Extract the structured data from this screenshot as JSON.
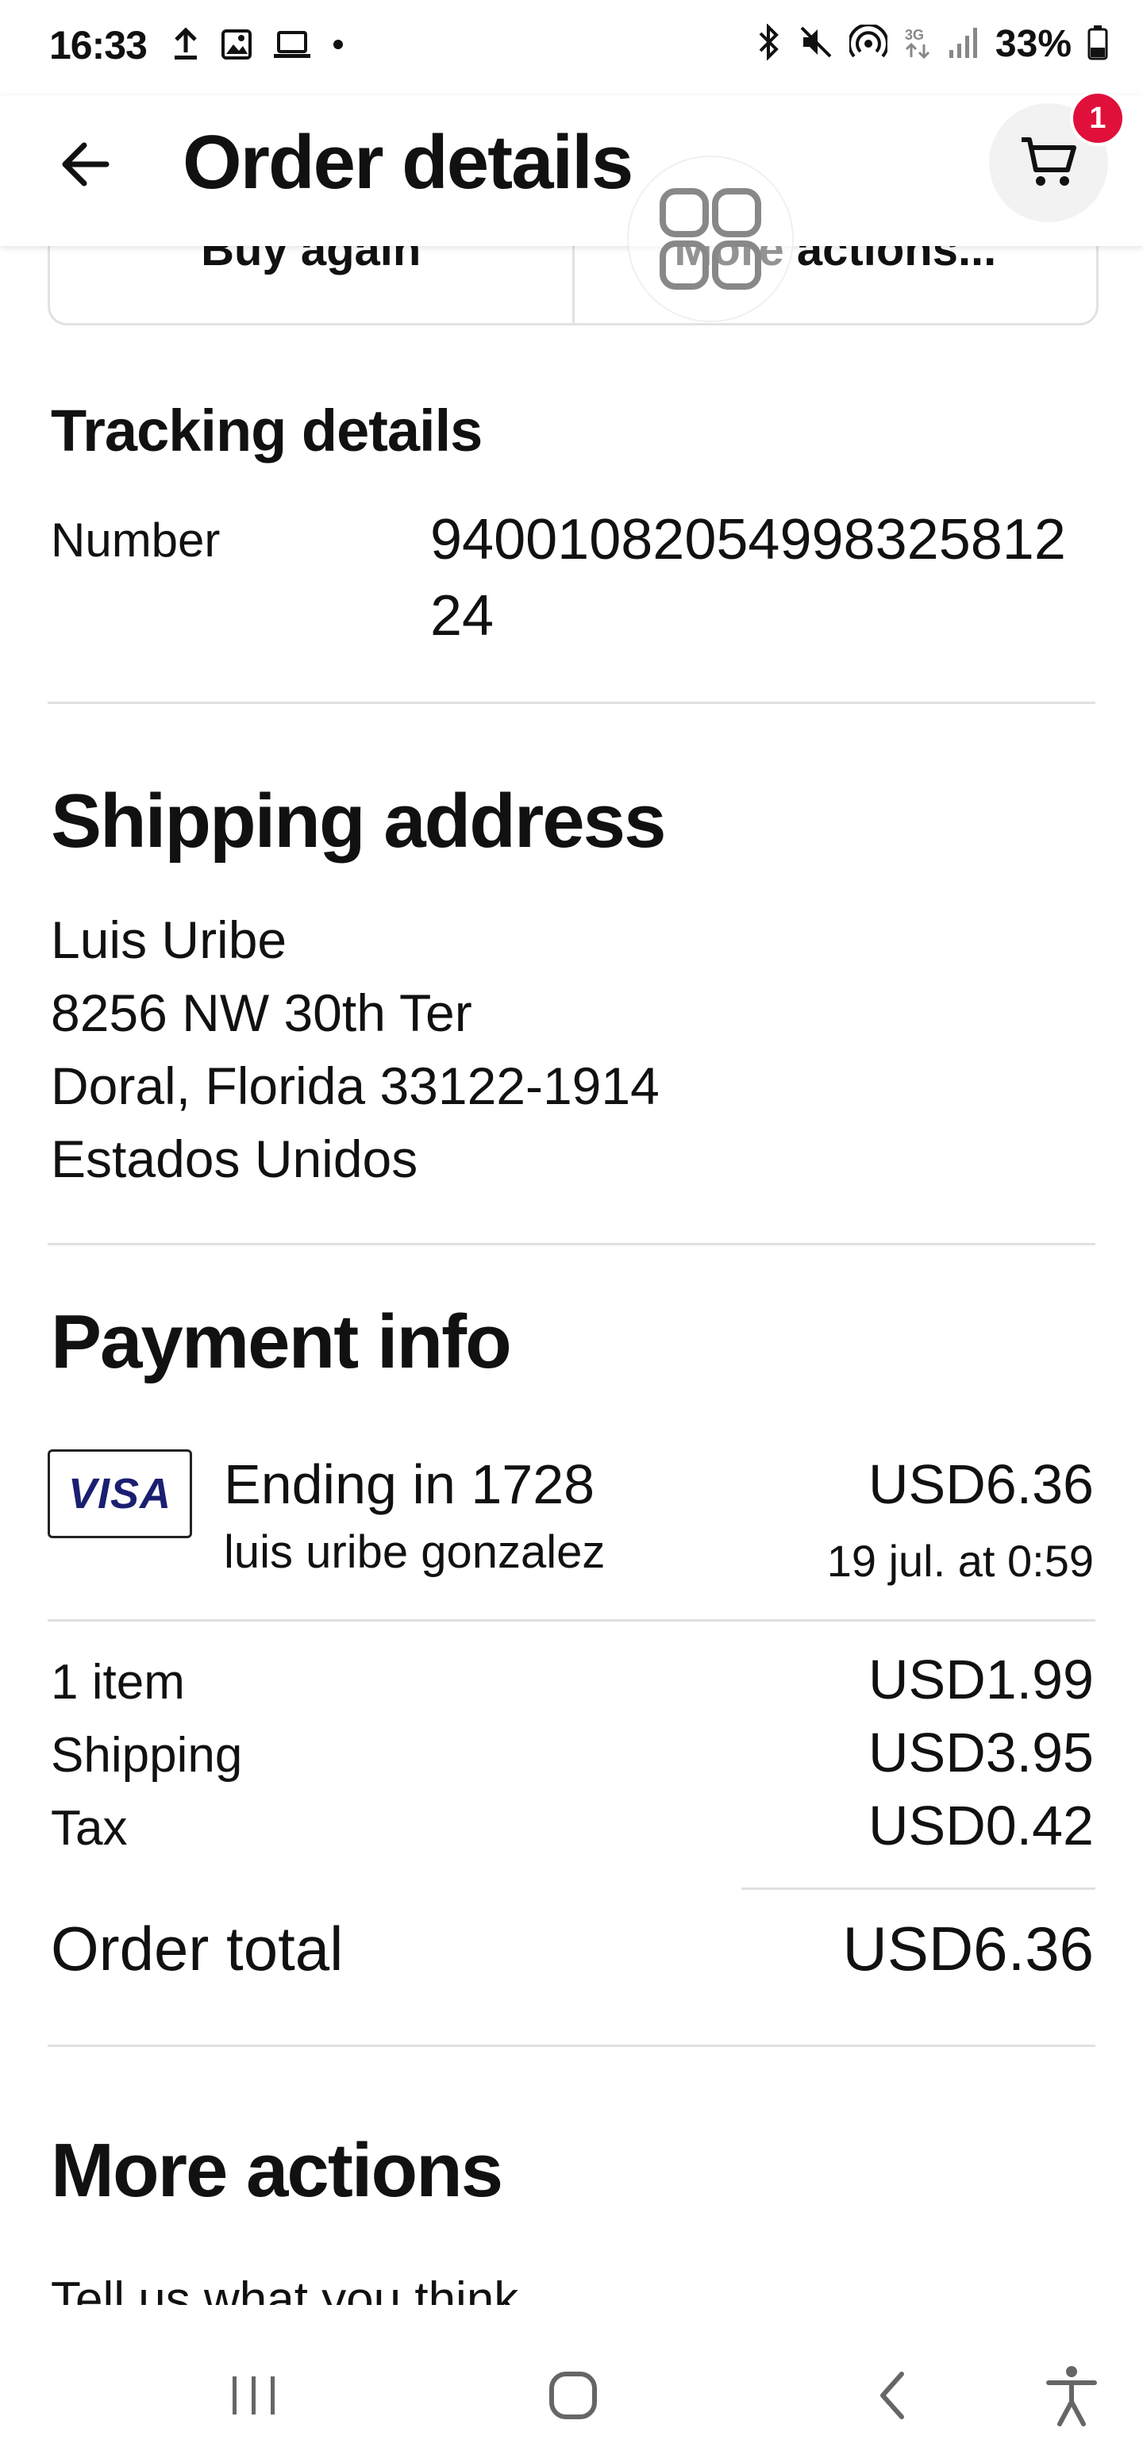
{
  "status_bar": {
    "time": "16:33",
    "battery": "33%",
    "left_icons": [
      "upload-icon",
      "image-icon",
      "laptop-icon",
      "dot-icon"
    ],
    "right_icons": [
      "bluetooth-icon",
      "mute-icon",
      "hotspot-icon",
      "3g-icon",
      "signal-icon",
      "battery-icon"
    ]
  },
  "header": {
    "title": "Order details",
    "cart_badge": "1"
  },
  "action_buttons": {
    "buy_again": "Buy again",
    "more_actions": "More actions..."
  },
  "tracking": {
    "title": "Tracking details",
    "number_label": "Number",
    "number_value": "9400108205499832581224"
  },
  "shipping": {
    "title": "Shipping address",
    "name": "Luis Uribe",
    "street": "8256 NW 30th Ter",
    "city_line": "Doral, Florida 33122-1914",
    "country": "Estados Unidos"
  },
  "payment": {
    "title": "Payment info",
    "card_brand": "VISA",
    "card_ending": "Ending in 1728",
    "card_holder": "luis uribe gonzalez",
    "amount": "USD6.36",
    "date": "19 jul. at 0:59",
    "items_label": "1 item",
    "items_value": "USD1.99",
    "shipping_label": "Shipping",
    "shipping_value": "USD3.95",
    "tax_label": "Tax",
    "tax_value": "USD0.42",
    "total_label": "Order total",
    "total_value": "USD6.36"
  },
  "more_actions": {
    "title": "More actions",
    "first_item": "Tell us what you think"
  },
  "colors": {
    "badge": "#e0103a",
    "visa": "#1a1f71",
    "divider": "#e0e0e0"
  }
}
